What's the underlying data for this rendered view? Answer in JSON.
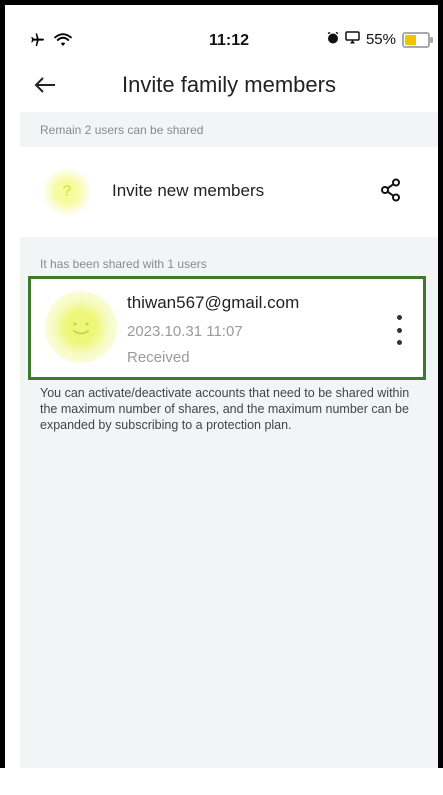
{
  "status_bar": {
    "time": "11:12",
    "battery": "55%",
    "battery_level": 0.55,
    "icons": [
      "airplane-icon",
      "wifi-icon",
      "alarm-icon",
      "screen-mirror-icon",
      "battery-icon"
    ]
  },
  "header": {
    "title": "Invite family members",
    "back_icon": "arrow-left-icon"
  },
  "remain_section": {
    "label": "Remain 2 users can be shared"
  },
  "invite": {
    "avatar_glyph": "?",
    "label": "Invite new members",
    "share_icon": "share-icon"
  },
  "shared_section": {
    "label": "It has been shared with 1 users"
  },
  "member": {
    "email": "thiwan567@gmail.com",
    "date": "2023.10.31 11:07",
    "status": "Received",
    "more_icon": "more-vertical-icon"
  },
  "info": {
    "text": "You can activate/deactivate accounts that need to be shared within the maximum number of shares, and the maximum number can be expanded by subscribing to a protection plan."
  },
  "colors": {
    "highlight_border": "#3d7a2b",
    "avatar_yellow": "#eef77a",
    "battery_fill": "#f2c300",
    "background": "#f3f4f6"
  }
}
